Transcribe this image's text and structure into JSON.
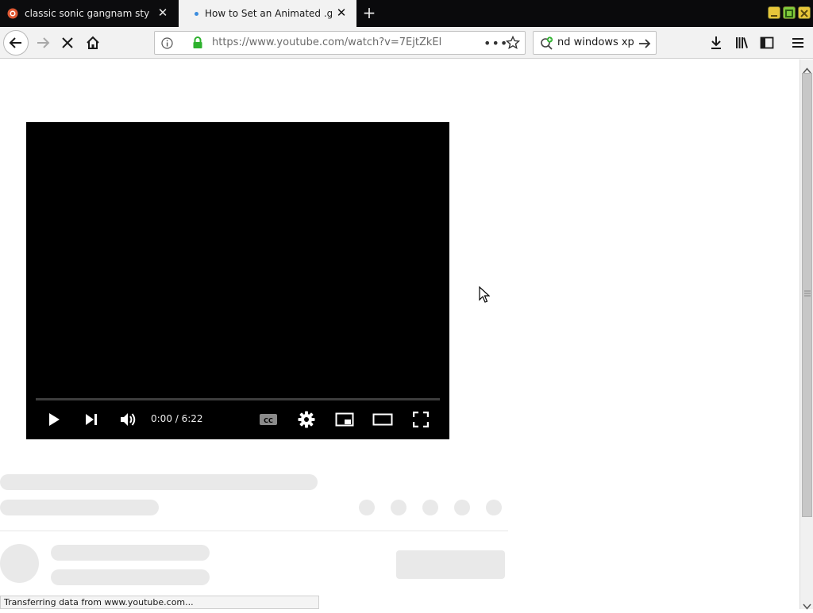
{
  "tabs": [
    {
      "title": "classic sonic gangnam style",
      "active": false
    },
    {
      "title": "How to Set an Animated .gif",
      "active": true
    }
  ],
  "new_tab_label": "+",
  "window_controls": [
    "minimize-icon",
    "maximize-icon",
    "close-icon"
  ],
  "nav": {
    "url": "https://www.youtube.com/watch?v=7EjtZkEl",
    "search_text": "nd windows xp"
  },
  "player": {
    "time": "0:00 / 6:22",
    "progress_fraction": 0
  },
  "status_bar": "Transferring data from www.youtube.com...",
  "colors": {
    "tab_bar": "#0a0a0c",
    "active_tab": "#f2f2f2",
    "toolbar": "#f2f2f2",
    "lock_green": "#2db12d",
    "skeleton": "#e9e9e9",
    "player_bg": "#000000"
  }
}
